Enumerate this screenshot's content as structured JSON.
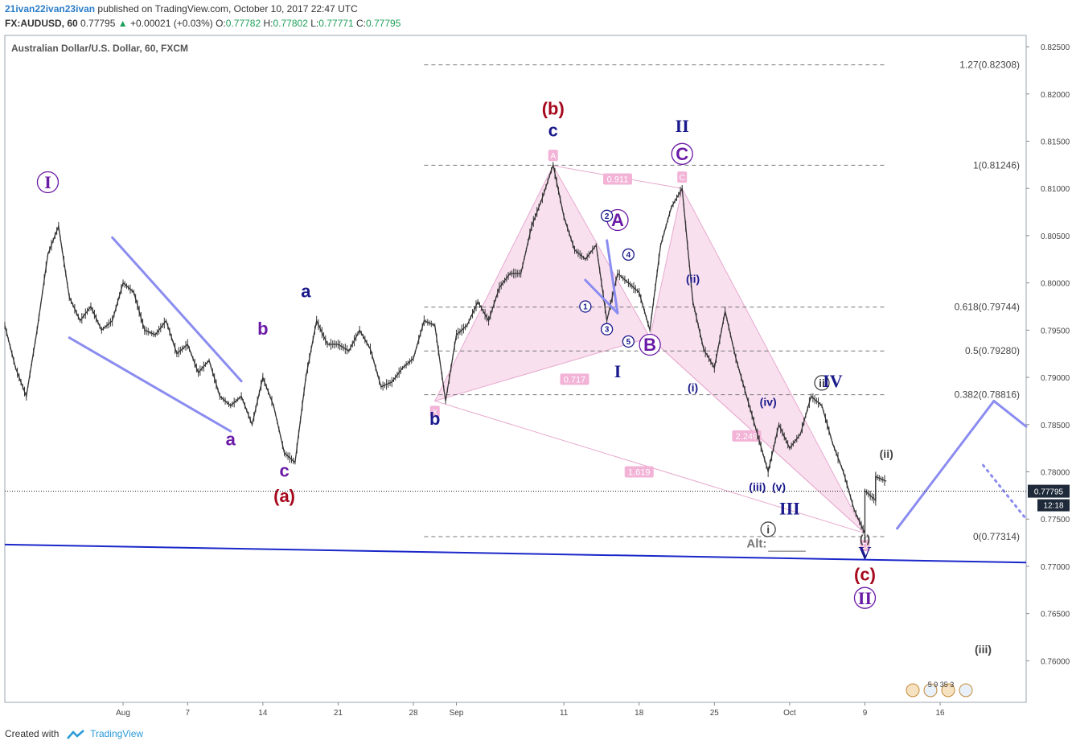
{
  "header": {
    "author": "21ivan22ivan23ivan",
    "published_text": "published on TradingView.com, October 10, 2017 22:47 UTC",
    "symbol": "FX:AUDUSD, 60",
    "last": "0.77795",
    "change": "+0.00021 (+0.03%)",
    "o_label": "O:",
    "o": "0.77782",
    "h_label": "H:",
    "h": "0.77802",
    "l_label": "L:",
    "l": "0.77771",
    "c_label": "C:",
    "c": "0.77795"
  },
  "footer": {
    "created_with": "Created with",
    "brand": "TradingView"
  },
  "colors": {
    "candles": "#333333",
    "pattern_fill": "#f4c6e2",
    "pattern_line": "#e7a9cf",
    "trend": "#8a8cf0",
    "support": "#1a27c9",
    "label_darkred": "#a6081c",
    "label_navy": "#1a1a8c",
    "label_purple": "#6b1aa6",
    "fib": "#777777",
    "price_tag": "#1e2a3a"
  },
  "chart_data": {
    "type": "line",
    "title": "Australian Dollar/U.S. Dollar, 60, FXCM",
    "xlabel": "",
    "ylabel": "",
    "x_ticks": [
      {
        "label": "Aug",
        "date": "2017-08-01"
      },
      {
        "label": "7",
        "date": "2017-08-07"
      },
      {
        "label": "14",
        "date": "2017-08-14"
      },
      {
        "label": "21",
        "date": "2017-08-21"
      },
      {
        "label": "28",
        "date": "2017-08-28"
      },
      {
        "label": "Sep",
        "date": "2017-09-01"
      },
      {
        "label": "11",
        "date": "2017-09-11"
      },
      {
        "label": "18",
        "date": "2017-09-18"
      },
      {
        "label": "25",
        "date": "2017-09-25"
      },
      {
        "label": "Oct",
        "date": "2017-10-02"
      },
      {
        "label": "9",
        "date": "2017-10-09"
      },
      {
        "label": "16",
        "date": "2017-10-16"
      }
    ],
    "xlim": [
      "2017-07-21",
      "2017-10-24"
    ],
    "ylim": [
      0.7556,
      0.8262
    ],
    "y_ticks": [
      "0.82500",
      "0.82000",
      "0.81500",
      "0.81000",
      "0.80500",
      "0.80000",
      "0.79500",
      "0.79000",
      "0.78500",
      "0.78000",
      "0.77500",
      "0.77000",
      "0.76500",
      "0.76000"
    ],
    "last_price": "0.77795",
    "countdown": "12:18",
    "series": [
      {
        "values": [
          [
            "2017-07-21",
            0.7955
          ],
          [
            "2017-07-22",
            0.791
          ],
          [
            "2017-07-23",
            0.788
          ],
          [
            "2017-07-24",
            0.795
          ],
          [
            "2017-07-25",
            0.803
          ],
          [
            "2017-07-26",
            0.806
          ],
          [
            "2017-07-27",
            0.7985
          ],
          [
            "2017-07-28",
            0.796
          ],
          [
            "2017-07-29",
            0.7975
          ],
          [
            "2017-07-30",
            0.795
          ],
          [
            "2017-07-31",
            0.796
          ],
          [
            "2017-08-01",
            0.8
          ],
          [
            "2017-08-02",
            0.799
          ],
          [
            "2017-08-03",
            0.795
          ],
          [
            "2017-08-04",
            0.7945
          ],
          [
            "2017-08-05",
            0.796
          ],
          [
            "2017-08-06",
            0.7925
          ],
          [
            "2017-08-07",
            0.7935
          ],
          [
            "2017-08-08",
            0.7905
          ],
          [
            "2017-08-09",
            0.7918
          ],
          [
            "2017-08-10",
            0.788
          ],
          [
            "2017-08-11",
            0.787
          ],
          [
            "2017-08-12",
            0.788
          ],
          [
            "2017-08-13",
            0.785
          ],
          [
            "2017-08-14",
            0.79
          ],
          [
            "2017-08-15",
            0.787
          ],
          [
            "2017-08-16",
            0.782
          ],
          [
            "2017-08-17",
            0.781
          ],
          [
            "2017-08-18",
            0.79
          ],
          [
            "2017-08-19",
            0.796
          ],
          [
            "2017-08-20",
            0.7935
          ],
          [
            "2017-08-21",
            0.7935
          ],
          [
            "2017-08-22",
            0.7928
          ],
          [
            "2017-08-23",
            0.795
          ],
          [
            "2017-08-24",
            0.793
          ],
          [
            "2017-08-25",
            0.789
          ],
          [
            "2017-08-26",
            0.7895
          ],
          [
            "2017-08-27",
            0.791
          ],
          [
            "2017-08-28",
            0.792
          ],
          [
            "2017-08-29",
            0.796
          ],
          [
            "2017-08-30",
            0.7955
          ],
          [
            "2017-08-31",
            0.7875
          ],
          [
            "2017-09-01",
            0.7945
          ],
          [
            "2017-09-02",
            0.7955
          ],
          [
            "2017-09-03",
            0.798
          ],
          [
            "2017-09-04",
            0.796
          ],
          [
            "2017-09-05",
            0.7995
          ],
          [
            "2017-09-06",
            0.801
          ],
          [
            "2017-09-07",
            0.801
          ],
          [
            "2017-09-08",
            0.806
          ],
          [
            "2017-09-09",
            0.809
          ],
          [
            "2017-09-10",
            0.8125
          ],
          [
            "2017-09-11",
            0.807
          ],
          [
            "2017-09-12",
            0.8035
          ],
          [
            "2017-09-13",
            0.8025
          ],
          [
            "2017-09-14",
            0.804
          ],
          [
            "2017-09-15",
            0.796
          ],
          [
            "2017-09-16",
            0.801
          ],
          [
            "2017-09-17",
            0.8
          ],
          [
            "2017-09-18",
            0.799
          ],
          [
            "2017-09-19",
            0.795
          ],
          [
            "2017-09-20",
            0.804
          ],
          [
            "2017-09-21",
            0.808
          ],
          [
            "2017-09-22",
            0.81
          ],
          [
            "2017-09-23",
            0.798
          ],
          [
            "2017-09-24",
            0.793
          ],
          [
            "2017-09-25",
            0.791
          ],
          [
            "2017-09-26",
            0.797
          ],
          [
            "2017-09-27",
            0.792
          ],
          [
            "2017-09-28",
            0.788
          ],
          [
            "2017-09-29",
            0.784
          ],
          [
            "2017-09-30",
            0.78
          ],
          [
            "2017-10-01",
            0.785
          ],
          [
            "2017-10-02",
            0.7825
          ],
          [
            "2017-10-03",
            0.784
          ],
          [
            "2017-10-04",
            0.788
          ],
          [
            "2017-10-05",
            0.787
          ],
          [
            "2017-10-06",
            0.783
          ],
          [
            "2017-10-07",
            0.78
          ],
          [
            "2017-10-08",
            0.776
          ],
          [
            "2017-10-09",
            0.7735
          ],
          [
            "2017-10-09",
            0.778
          ],
          [
            "2017-10-10",
            0.777
          ],
          [
            "2017-10-10",
            0.7795
          ],
          [
            "2017-10-11",
            0.779
          ]
        ]
      }
    ],
    "fib_levels": [
      {
        "label": "1.27(0.82308)",
        "value": 0.82308
      },
      {
        "label": "1(0.81246)",
        "value": 0.81246
      },
      {
        "label": "0.618(0.79744)",
        "value": 0.79744
      },
      {
        "label": "0.5(0.79280)",
        "value": 0.7928
      },
      {
        "label": "0.382(0.78816)",
        "value": 0.78816
      },
      {
        "label": "0(0.77314)",
        "value": 0.77314
      }
    ],
    "fib_xstart": "2017-08-29",
    "fib_xend": "2017-10-11",
    "pattern_points": {
      "X": [
        "2017-08-30",
        0.7875
      ],
      "A": [
        "2017-09-10",
        0.8124
      ],
      "B": [
        "2017-09-19",
        0.7942
      ],
      "C": [
        "2017-09-22",
        0.81
      ],
      "D": [
        "2017-10-09",
        0.7735
      ]
    },
    "pattern_ratios": [
      {
        "text": "0.911",
        "at": [
          "2017-09-16",
          0.811
        ]
      },
      {
        "text": "0.717",
        "at": [
          "2017-09-12",
          0.7898
        ]
      },
      {
        "text": "1.619",
        "at": [
          "2017-09-18",
          0.78
        ]
      },
      {
        "text": "2.249",
        "at": [
          "2017-09-28",
          0.7838
        ]
      }
    ],
    "pattern_point_labels": [
      {
        "text": "X",
        "at": [
          "2017-08-30",
          0.7864
        ]
      },
      {
        "text": "A",
        "at": [
          "2017-09-10",
          0.8135
        ]
      },
      {
        "text": "C",
        "at": [
          "2017-09-22",
          0.8112
        ]
      },
      {
        "text": "D",
        "at": [
          "2017-10-09",
          0.7722
        ]
      }
    ],
    "trend_lines": [
      {
        "from": [
          "2017-07-27",
          0.7942
        ],
        "to": [
          "2017-08-11",
          0.7843
        ],
        "style": "solid"
      },
      {
        "from": [
          "2017-07-31",
          0.8048
        ],
        "to": [
          "2017-08-12",
          0.7896
        ],
        "style": "solid"
      },
      {
        "from": [
          "2017-09-13",
          0.8003
        ],
        "to": [
          "2017-09-16",
          0.7968
        ],
        "style": "solid"
      },
      {
        "from": [
          "2017-09-15",
          0.8045
        ],
        "to": [
          "2017-09-16",
          0.7968
        ],
        "style": "solid"
      },
      {
        "from": [
          "2017-10-12",
          0.774
        ],
        "to": [
          "2017-10-21",
          0.7875
        ],
        "style": "solid"
      },
      {
        "from": [
          "2017-10-21",
          0.7875
        ],
        "to": [
          "2017-10-24",
          0.7848
        ],
        "style": "solid"
      },
      {
        "from": [
          "2017-10-20",
          0.7807
        ],
        "to": [
          "2017-10-24",
          0.775
        ],
        "style": "dotted"
      }
    ],
    "support_line": {
      "from": [
        "2017-07-21",
        0.7723
      ],
      "to": [
        "2017-10-24",
        0.7704
      ]
    },
    "alt_line": {
      "from": [
        "2017-09-30",
        0.7716
      ],
      "to": [
        "2017-10-02",
        0.7716
      ]
    },
    "wave_labels": [
      {
        "text": "I",
        "at": [
          "2017-07-25",
          0.81
        ],
        "color": "purple",
        "circled": true
      },
      {
        "text": "a",
        "at": [
          "2017-08-11",
          0.7828
        ],
        "color": "purple"
      },
      {
        "text": "b",
        "at": [
          "2017-08-14",
          0.7945
        ],
        "color": "purple"
      },
      {
        "text": "c",
        "at": [
          "2017-08-16",
          0.7795
        ],
        "color": "purple"
      },
      {
        "text": "(a)",
        "at": [
          "2017-08-16",
          0.7768
        ],
        "color": "darkred"
      },
      {
        "text": "a",
        "at": [
          "2017-08-18",
          0.7985
        ],
        "color": "navy"
      },
      {
        "text": "b",
        "at": [
          "2017-08-30",
          0.785
        ],
        "color": "navy"
      },
      {
        "text": "(b)",
        "at": [
          "2017-09-10",
          0.8178
        ],
        "color": "darkred"
      },
      {
        "text": "c",
        "at": [
          "2017-09-10",
          0.8155
        ],
        "color": "navy"
      },
      {
        "text": "II",
        "at": [
          "2017-09-22",
          0.816
        ],
        "color": "navy"
      },
      {
        "text": "C",
        "at": [
          "2017-09-22",
          0.813
        ],
        "color": "purple",
        "circled": true
      },
      {
        "text": "A",
        "at": [
          "2017-09-16",
          0.806
        ],
        "color": "purple",
        "circled": true
      },
      {
        "text": "B",
        "at": [
          "2017-09-19",
          0.7928
        ],
        "color": "purple",
        "circled": true
      },
      {
        "text": "I",
        "at": [
          "2017-09-16",
          0.79
        ],
        "color": "navy"
      },
      {
        "text": "(ii)",
        "at": [
          "2017-09-23",
          0.8
        ],
        "color": "navy",
        "small": true
      },
      {
        "text": "(i)",
        "at": [
          "2017-09-23",
          0.7885
        ],
        "color": "navy",
        "small": true
      },
      {
        "text": "(iv)",
        "at": [
          "2017-09-30",
          0.787
        ],
        "color": "navy",
        "small": true
      },
      {
        "text": "(iii)",
        "at": [
          "2017-09-29",
          0.778
        ],
        "color": "navy",
        "small": true
      },
      {
        "text": "(v)",
        "at": [
          "2017-10-01",
          0.778
        ],
        "color": "navy",
        "small": true
      },
      {
        "text": "III",
        "at": [
          "2017-10-02",
          0.7755
        ],
        "color": "navy"
      },
      {
        "text": "ii",
        "at": [
          "2017-10-05",
          0.789
        ],
        "color": "gray",
        "circled": true,
        "small": true
      },
      {
        "text": "IV",
        "at": [
          "2017-10-06",
          0.789
        ],
        "color": "navy"
      },
      {
        "text": "i",
        "at": [
          "2017-09-30",
          0.7735
        ],
        "color": "gray",
        "circled": true,
        "small": true
      },
      {
        "text": "(i)",
        "at": [
          "2017-10-09",
          0.7725
        ],
        "color": "gray",
        "small": true
      },
      {
        "text": "V",
        "at": [
          "2017-10-09",
          0.7708
        ],
        "color": "navy"
      },
      {
        "text": "(c)",
        "at": [
          "2017-10-09",
          0.7685
        ],
        "color": "darkred"
      },
      {
        "text": "II",
        "at": [
          "2017-10-09",
          0.766
        ],
        "color": "purple",
        "circled": true
      },
      {
        "text": "(ii)",
        "at": [
          "2017-10-11",
          0.7815
        ],
        "color": "gray",
        "small": true
      },
      {
        "text": "(iii)",
        "at": [
          "2017-10-20",
          0.7608
        ],
        "color": "gray",
        "small": true
      },
      {
        "text": "1",
        "at": [
          "2017-09-13",
          0.7972
        ],
        "color": "navy",
        "circled": true,
        "tiny": true
      },
      {
        "text": "2",
        "at": [
          "2017-09-15",
          0.8068
        ],
        "color": "navy",
        "circled": true,
        "tiny": true
      },
      {
        "text": "3",
        "at": [
          "2017-09-15",
          0.7948
        ],
        "color": "navy",
        "circled": true,
        "tiny": true
      },
      {
        "text": "4",
        "at": [
          "2017-09-17",
          0.8027
        ],
        "color": "navy",
        "circled": true,
        "tiny": true
      },
      {
        "text": "5",
        "at": [
          "2017-09-17",
          0.7935
        ],
        "color": "navy",
        "circled": true,
        "tiny": true
      }
    ],
    "alt_text": {
      "text": "Alt:",
      "at": [
        "2017-09-28",
        0.772
      ]
    },
    "legend_icons_text": "5 9 35 3"
  }
}
